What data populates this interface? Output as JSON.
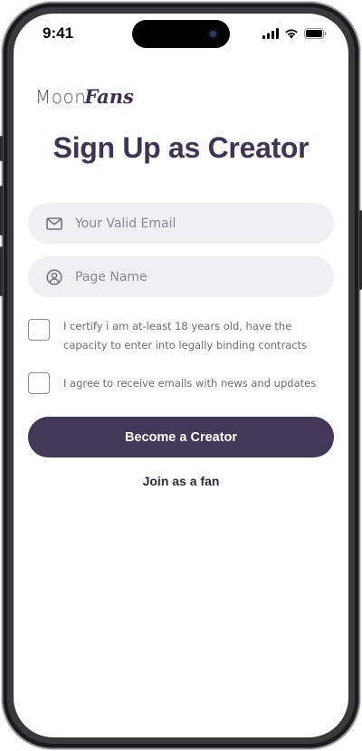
{
  "status_bar": {
    "time": "9:41",
    "icons": [
      "cellular-signal-icon",
      "wifi-icon",
      "battery-icon"
    ]
  },
  "brand": {
    "logo_part1": "Moon",
    "logo_part2": "Fans"
  },
  "page": {
    "title": "Sign Up as Creator"
  },
  "form": {
    "email": {
      "icon": "mail-icon",
      "placeholder": "Your Valid Email",
      "value": ""
    },
    "page_name": {
      "icon": "user-circle-icon",
      "placeholder": "Page Name",
      "value": ""
    },
    "age_checkbox": {
      "checked": false,
      "label": "I certify i am at-least 18 years old, have the capacity to enter into legally binding contracts"
    },
    "news_checkbox": {
      "checked": false,
      "label": "I agree to receive emails with news and updates"
    },
    "submit_label": "Become a Creator",
    "alt_link_label": "Join as a fan"
  },
  "colors": {
    "primary": "#443757",
    "title": "#3f3455",
    "field_bg": "#f0eff3",
    "muted_text": "#6e6b76"
  }
}
